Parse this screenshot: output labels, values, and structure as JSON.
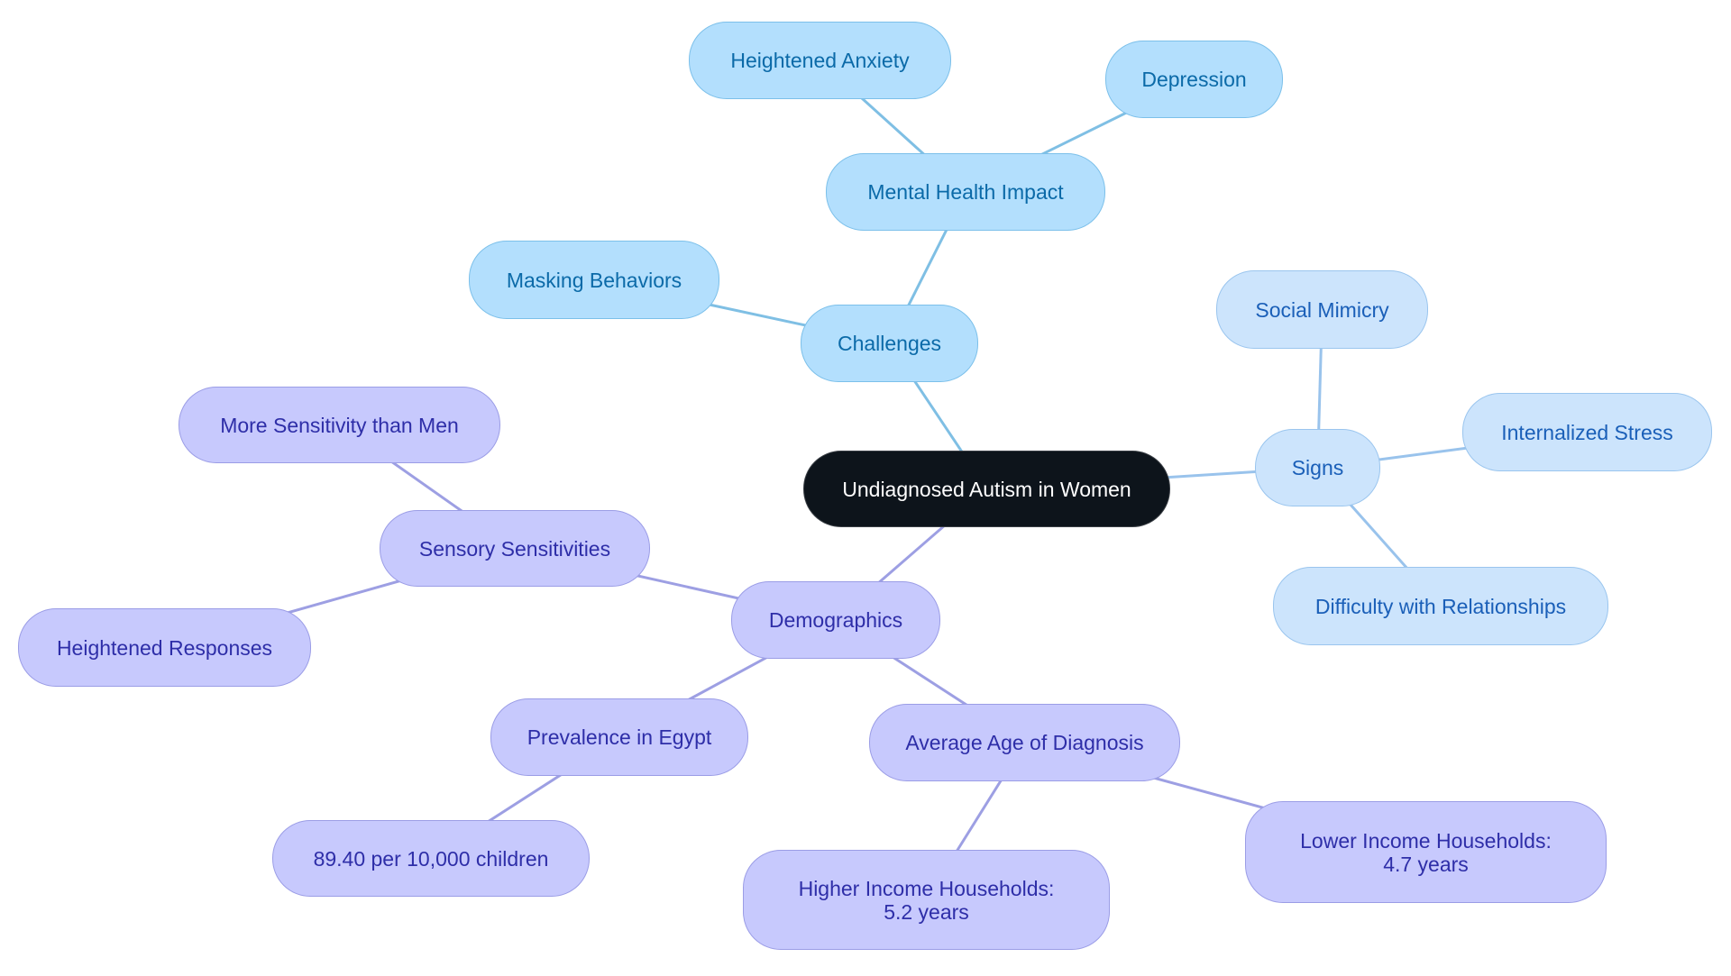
{
  "title": "Undiagnosed Autism in Women",
  "colors": {
    "root_fill": "#0d141b",
    "challenges_fill": "#b3dffd",
    "challenges_edge": "#7fbfe4",
    "signs_fill": "#cce4fc",
    "signs_edge": "#99c3ec",
    "demographics_fill": "#c7c9fd",
    "demographics_edge": "#9d9fe3"
  },
  "nodes": {
    "root": "Undiagnosed Autism in Women",
    "challenges": "Challenges",
    "mental_health_impact": "Mental Health Impact",
    "heightened_anxiety": "Heightened Anxiety",
    "depression": "Depression",
    "masking_behaviors": "Masking Behaviors",
    "signs": "Signs",
    "social_mimicry": "Social Mimicry",
    "internalized_stress": "Internalized Stress",
    "difficulty_relationships": "Difficulty with Relationships",
    "demographics": "Demographics",
    "sensory_sensitivities": "Sensory Sensitivities",
    "more_sensitivity": "More Sensitivity than Men",
    "heightened_responses": "Heightened Responses",
    "prevalence_egypt": "Prevalence in Egypt",
    "prevalence_value": "89.40 per 10,000 children",
    "average_age": "Average Age of Diagnosis",
    "higher_income": "Higher Income Households: 5.2 years",
    "lower_income": "Lower Income Households: 4.7 years"
  },
  "edges": [
    [
      "root",
      "challenges",
      "challenges_edge"
    ],
    [
      "challenges",
      "mental_health_impact",
      "challenges_edge"
    ],
    [
      "mental_health_impact",
      "heightened_anxiety",
      "challenges_edge"
    ],
    [
      "mental_health_impact",
      "depression",
      "challenges_edge"
    ],
    [
      "challenges",
      "masking_behaviors",
      "challenges_edge"
    ],
    [
      "root",
      "signs",
      "signs_edge"
    ],
    [
      "signs",
      "social_mimicry",
      "signs_edge"
    ],
    [
      "signs",
      "internalized_stress",
      "signs_edge"
    ],
    [
      "signs",
      "difficulty_relationships",
      "signs_edge"
    ],
    [
      "root",
      "demographics",
      "demographics_edge"
    ],
    [
      "demographics",
      "sensory_sensitivities",
      "demographics_edge"
    ],
    [
      "sensory_sensitivities",
      "more_sensitivity",
      "demographics_edge"
    ],
    [
      "sensory_sensitivities",
      "heightened_responses",
      "demographics_edge"
    ],
    [
      "demographics",
      "prevalence_egypt",
      "demographics_edge"
    ],
    [
      "prevalence_egypt",
      "prevalence_value",
      "demographics_edge"
    ],
    [
      "demographics",
      "average_age",
      "demographics_edge"
    ],
    [
      "average_age",
      "higher_income",
      "demographics_edge"
    ],
    [
      "average_age",
      "lower_income",
      "demographics_edge"
    ]
  ]
}
